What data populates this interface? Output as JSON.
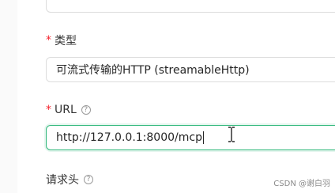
{
  "form": {
    "type": {
      "label": "类型",
      "required_mark": "*",
      "value": "可流式传输的HTTP (streamableHttp)"
    },
    "url": {
      "label": "URL",
      "required_mark": "*",
      "help_glyph": "?",
      "value": "http://127.0.0.1:8000/mcp"
    },
    "headers": {
      "label": "请求头",
      "help_glyph": "?"
    }
  },
  "watermark": "CSDN @谢白羽",
  "colors": {
    "focus_border": "#2fb77a",
    "required": "#f5222d"
  }
}
